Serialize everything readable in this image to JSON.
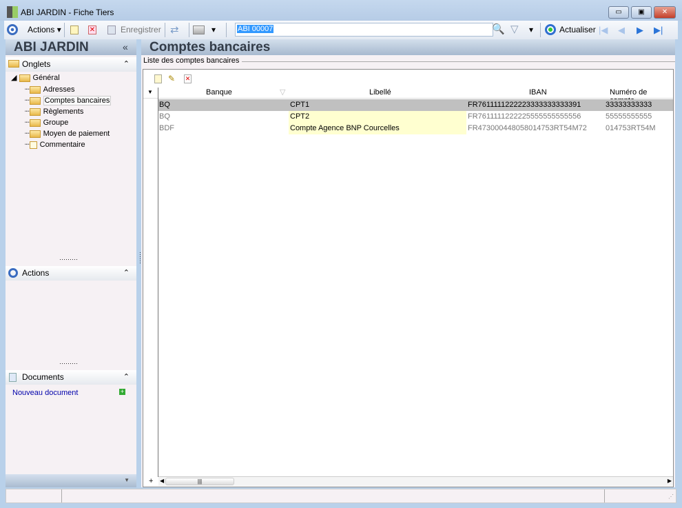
{
  "window": {
    "title": "ABI JARDIN -  Fiche Tiers",
    "minimize": "▭",
    "maximize": "▣",
    "close": "✕"
  },
  "toolbar": {
    "actions_label": "Actions",
    "save_label": "Enregistrer",
    "search_value": "ABI 00007",
    "refresh_label": "Actualiser"
  },
  "left": {
    "title": "ABI JARDIN",
    "collapse": "«",
    "onglets": {
      "label": "Onglets",
      "root": "Général",
      "items": [
        "Adresses",
        "Comptes bancaires",
        "Règlements",
        "Groupe",
        "Moyen de paiement",
        "Commentaire"
      ],
      "selected": "Comptes bancaires"
    },
    "actions": {
      "label": "Actions"
    },
    "documents": {
      "label": "Documents",
      "new_link": "Nouveau document"
    }
  },
  "main": {
    "title": "Comptes bancaires",
    "group_label": "Liste des comptes bancaires",
    "columns": [
      "Banque",
      "Libellé",
      "IBAN",
      "Numéro de compte"
    ],
    "rows": [
      {
        "banque": "BQ",
        "libelle": "CPT1",
        "iban": "FR7611111222223333333333391",
        "numero": "33333333333"
      },
      {
        "banque": "BQ",
        "libelle": "CPT2",
        "iban": "FR7611111222225555555555556",
        "numero": "55555555555"
      },
      {
        "banque": "BDF",
        "libelle": "Compte Agence BNP Courcelles",
        "iban": "FR473000448058014753RT54M72",
        "numero": "014753RT54M"
      }
    ]
  },
  "colors": {
    "selected_row": "#c0c0c0",
    "highlight_cell": "#ffffd0",
    "link": "#0000aa"
  }
}
